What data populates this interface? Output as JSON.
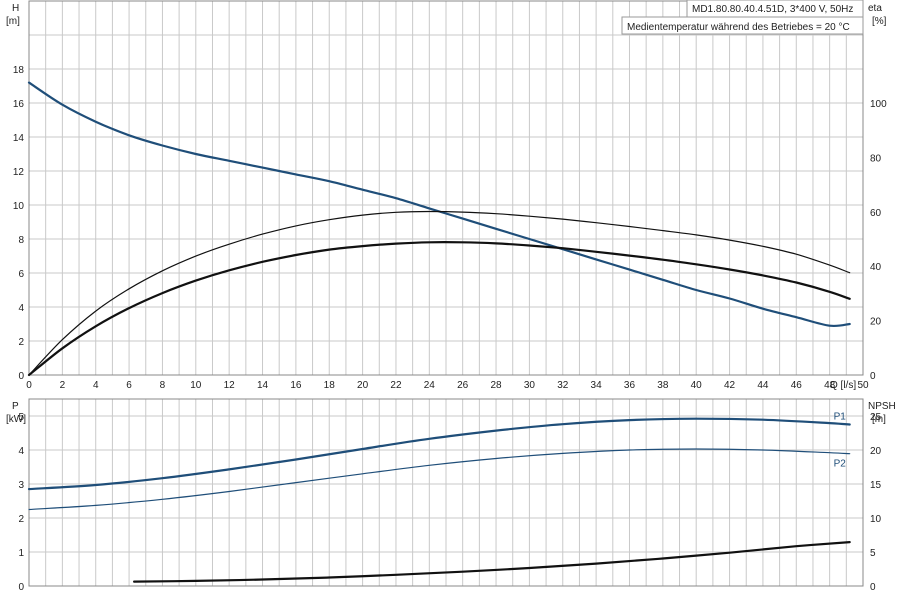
{
  "info": {
    "model": "MD1.80.80.40.4.51D, 3*400 V, 50Hz",
    "medium": "Medientemperatur während des Betriebes = 20 °C"
  },
  "chart_data": [
    {
      "type": "line",
      "xlabel": "Q [l/s]",
      "ylabel_top": "H",
      "ylabel_unit": "[m]",
      "y2label_top": "eta",
      "y2label_unit": "[%]",
      "xlim": [
        0,
        50
      ],
      "ylim": [
        0,
        22
      ],
      "y2lim": [
        0,
        137.5
      ],
      "x_ticks": [
        "0",
        "2",
        "4",
        "6",
        "8",
        "10",
        "12",
        "14",
        "16",
        "18",
        "20",
        "22",
        "24",
        "26",
        "28",
        "30",
        "32",
        "34",
        "36",
        "38",
        "40",
        "42",
        "44",
        "46",
        "48",
        "50"
      ],
      "y_ticks": [
        "0",
        "2",
        "4",
        "6",
        "8",
        "10",
        "12",
        "14",
        "16",
        "18"
      ],
      "y2_ticks": [
        "0",
        "20",
        "40",
        "60",
        "80",
        "100"
      ],
      "grid": true,
      "series": [
        {
          "axis": "left",
          "color": "#1f4e79",
          "width": 2.2,
          "x": [
            0,
            2,
            4,
            6,
            8,
            10,
            12,
            14,
            16,
            18,
            20,
            22,
            24,
            26,
            28,
            30,
            32,
            34,
            36,
            38,
            40,
            42,
            44,
            46,
            48,
            49.2
          ],
          "values": [
            17.2,
            15.9,
            14.9,
            14.1,
            13.5,
            13.0,
            12.6,
            12.2,
            11.8,
            11.4,
            10.9,
            10.4,
            9.8,
            9.2,
            8.6,
            8.0,
            7.4,
            6.8,
            6.2,
            5.6,
            5.0,
            4.5,
            3.9,
            3.4,
            2.9,
            3.0
          ]
        },
        {
          "axis": "right",
          "color": "#111111",
          "width": 1.2,
          "x": [
            0,
            2,
            4,
            6,
            8,
            10,
            12,
            14,
            16,
            18,
            20,
            22,
            24,
            26,
            28,
            30,
            32,
            34,
            36,
            38,
            40,
            42,
            44,
            46,
            48,
            49.2
          ],
          "values": [
            0,
            13,
            23.5,
            31.7,
            38.3,
            43.7,
            48.1,
            51.8,
            54.8,
            57.1,
            58.8,
            59.8,
            60.1,
            59.9,
            59.3,
            58.4,
            57.3,
            56.0,
            54.6,
            53.1,
            51.5,
            49.6,
            47.3,
            44.4,
            40.4,
            37.6
          ]
        },
        {
          "axis": "right",
          "color": "#111111",
          "width": 2.2,
          "x": [
            0,
            2,
            4,
            6,
            8,
            10,
            12,
            14,
            16,
            18,
            20,
            22,
            24,
            26,
            28,
            30,
            32,
            34,
            36,
            38,
            40,
            42,
            44,
            46,
            48,
            49.2
          ],
          "values": [
            0,
            9.8,
            17.9,
            24.6,
            30.1,
            34.7,
            38.5,
            41.6,
            44.1,
            46.1,
            47.4,
            48.3,
            48.8,
            48.8,
            48.4,
            47.6,
            46.6,
            45.3,
            43.9,
            42.4,
            40.7,
            38.8,
            36.6,
            34.0,
            30.6,
            28.0
          ]
        }
      ]
    },
    {
      "type": "line",
      "xlim": [
        0,
        50
      ],
      "ylabel_top": "P",
      "ylabel_unit": "[kW]",
      "y2label_top": "NPSH",
      "y2label_unit": "[m]",
      "ylim": [
        0,
        5.5
      ],
      "y2lim": [
        0,
        27.5
      ],
      "y_ticks": [
        "0",
        "1",
        "2",
        "3",
        "4",
        "5"
      ],
      "y2_ticks": [
        "0",
        "5",
        "10",
        "15",
        "20",
        "25"
      ],
      "grid": true,
      "series": [
        {
          "name": "P1",
          "axis": "left",
          "color": "#1f4e79",
          "width": 2.2,
          "x": [
            0,
            4,
            8,
            12,
            16,
            20,
            24,
            28,
            32,
            36,
            40,
            44,
            48,
            49.2
          ],
          "values": [
            2.85,
            2.97,
            3.17,
            3.43,
            3.72,
            4.03,
            4.33,
            4.57,
            4.76,
            4.88,
            4.92,
            4.89,
            4.79,
            4.75
          ]
        },
        {
          "name": "P2",
          "axis": "left",
          "color": "#1f4e79",
          "width": 1.2,
          "x": [
            0,
            4,
            8,
            12,
            16,
            20,
            24,
            28,
            32,
            36,
            40,
            44,
            48,
            49.2
          ],
          "values": [
            2.25,
            2.37,
            2.55,
            2.78,
            3.04,
            3.3,
            3.55,
            3.75,
            3.9,
            4.0,
            4.03,
            4.0,
            3.92,
            3.89
          ]
        },
        {
          "axis": "right",
          "color": "#111111",
          "width": 2.2,
          "x": [
            6.3,
            10,
            14,
            18,
            22,
            26,
            30,
            34,
            38,
            42,
            46,
            49.2
          ],
          "values": [
            0.65,
            0.75,
            0.95,
            1.25,
            1.65,
            2.1,
            2.65,
            3.3,
            4.05,
            4.9,
            5.85,
            6.45
          ]
        }
      ]
    }
  ]
}
